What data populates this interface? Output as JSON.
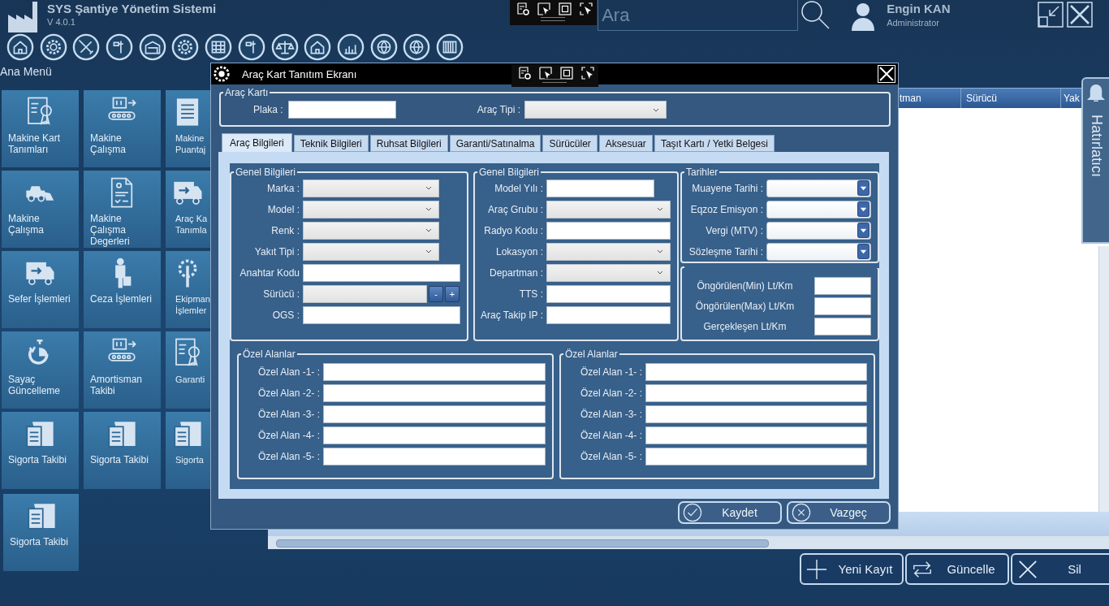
{
  "app": {
    "title": "SYS Şantiye Yönetim Sistemi",
    "version": "V 4.0.1"
  },
  "search": {
    "placeholder": "Ara"
  },
  "user": {
    "name": "Engin KAN",
    "role": "Administrator"
  },
  "menu": {
    "title": "Ana Menü",
    "tiles": [
      {
        "label": "Makine Kart Tanımları",
        "kind": "certificate"
      },
      {
        "label": "Makine Çalışma",
        "kind": "conveyor"
      },
      {
        "label": "Makine Puantaj",
        "kind": "checklist"
      },
      {
        "label": "Makine Çalışma",
        "kind": "loader"
      },
      {
        "label": "Makine Çalışma Degerleri",
        "kind": "document"
      },
      {
        "label": "Araç Ka Tanımla",
        "kind": "truck"
      },
      {
        "label": "Sefer İşlemleri",
        "kind": "truck"
      },
      {
        "label": "Ceza İşlemleri",
        "kind": "worker"
      },
      {
        "label": "Ekipman İşlemler",
        "kind": "gear"
      },
      {
        "label": "Sayaç Güncelleme",
        "kind": "stopwatch"
      },
      {
        "label": "Amortisman Takibi",
        "kind": "conveyor"
      },
      {
        "label": "Garanti",
        "kind": "certificate"
      },
      {
        "label": "Sigorta Takibi",
        "kind": "clipboard"
      },
      {
        "label": "Sigorta Takibi",
        "kind": "clipboard"
      },
      {
        "label": "Sigorta",
        "kind": "clipboard"
      },
      {
        "label": "Sigorta Takibi",
        "kind": "clipboard"
      }
    ]
  },
  "table": {
    "columns": [
      "tman",
      "Sürücü",
      "Yak"
    ]
  },
  "reminder": {
    "label": "Hatırlatıcı"
  },
  "actions": [
    {
      "label": "Yeni Kayıt",
      "kind": "add"
    },
    {
      "label": "Güncelle",
      "kind": "update"
    },
    {
      "label": "Sil",
      "kind": "delete"
    }
  ],
  "dialog": {
    "title": "Araç Kart Tanıtım Ekranı",
    "card": {
      "title": "Araç Kartı",
      "fields": [
        {
          "label": "Plaka :",
          "kind": "text"
        },
        {
          "label": "Araç Tipi :",
          "kind": "combo"
        }
      ]
    },
    "tabs": [
      {
        "label": "Araç Bilgileri",
        "selected": true
      },
      {
        "label": "Teknik Bilgileri",
        "selected": false
      },
      {
        "label": "Ruhsat Bilgileri",
        "selected": false
      },
      {
        "label": "Garanti/Satınalma",
        "selected": false
      },
      {
        "label": "Sürücüler",
        "selected": false
      },
      {
        "label": "Aksesuar",
        "selected": false
      },
      {
        "label": "Taşıt Kartı / Yetki Belgesi",
        "selected": false
      }
    ],
    "general_1": {
      "title": "Genel Bilgileri",
      "fields": [
        {
          "label": "Marka :",
          "kind": "combo"
        },
        {
          "label": "Model :",
          "kind": "combo"
        },
        {
          "label": "Renk :",
          "kind": "combo"
        },
        {
          "label": "Yakıt Tipi :",
          "kind": "combo"
        },
        {
          "label": "Anahtar Kodu",
          "kind": "text"
        },
        {
          "label": "Sürücü :",
          "kind": "driver",
          "buttons": [
            "-",
            "+"
          ]
        },
        {
          "label": "OGS :",
          "kind": "text"
        }
      ]
    },
    "general_2": {
      "title": "Genel Bilgileri",
      "fields": [
        {
          "label": "Model Yılı :",
          "kind": "short"
        },
        {
          "label": "Araç Grubu :",
          "kind": "combo"
        },
        {
          "label": "Radyo Kodu :",
          "kind": "text"
        },
        {
          "label": "Lokasyon :",
          "kind": "combo"
        },
        {
          "label": "Departman :",
          "kind": "combo"
        },
        {
          "label": "TTS :",
          "kind": "text"
        },
        {
          "label": "Araç Takip IP :",
          "kind": "text"
        }
      ]
    },
    "dates": {
      "title": "Tarihler",
      "fields": [
        {
          "label": "Muayene Tarihi :",
          "kind": "date"
        },
        {
          "label": "Eqzoz Emisyon :",
          "kind": "date"
        },
        {
          "label": "Vergi (MTV) :",
          "kind": "date"
        },
        {
          "label": "Sözleşme Tarihi :",
          "kind": "date"
        }
      ]
    },
    "consumption": {
      "fields": [
        {
          "label": "Öngörülen(Min) Lt/Km",
          "kind": "small"
        },
        {
          "label": "Öngörülen(Max) Lt/Km",
          "kind": "small"
        },
        {
          "label": "Gerçekleşen Lt/Km",
          "kind": "small"
        }
      ]
    },
    "custom_1": {
      "title": "Özel Alanlar",
      "fields": [
        {
          "label": "Özel Alan -1- :",
          "kind": "text"
        },
        {
          "label": "Özel Alan -2- :",
          "kind": "text"
        },
        {
          "label": "Özel Alan -3- :",
          "kind": "text"
        },
        {
          "label": "Özel Alan -4- :",
          "kind": "text"
        },
        {
          "label": "Özel Alan -5- :",
          "kind": "text"
        }
      ]
    },
    "custom_2": {
      "title": "Özel Alanlar",
      "fields": [
        {
          "label": "Özel Alan -1- :",
          "kind": "text"
        },
        {
          "label": "Özel Alan -2- :",
          "kind": "text"
        },
        {
          "label": "Özel Alan -3- :",
          "kind": "text"
        },
        {
          "label": "Özel Alan -4- :",
          "kind": "text"
        },
        {
          "label": "Özel Alan -5- :",
          "kind": "text"
        }
      ]
    },
    "buttons": [
      {
        "label": "Kaydet",
        "kind": "save"
      },
      {
        "label": "Vazgeç",
        "kind": "cancel"
      }
    ]
  }
}
